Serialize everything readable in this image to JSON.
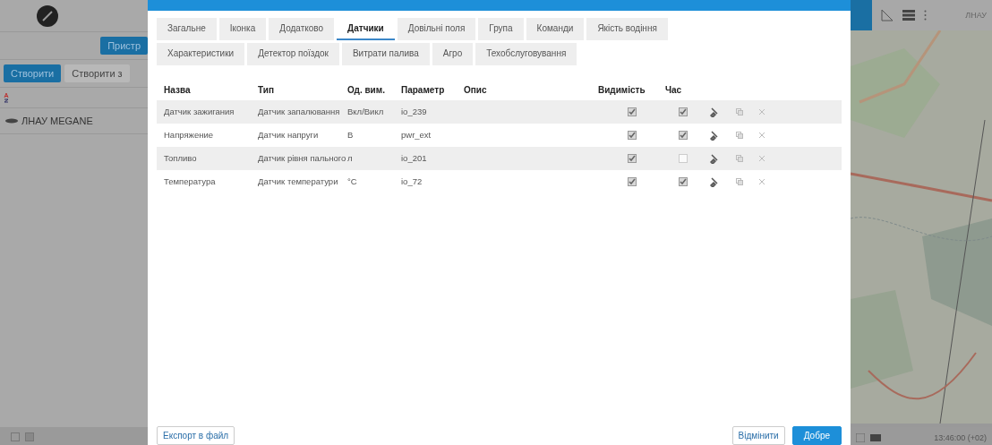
{
  "sidebar": {
    "device_button": "Пристр",
    "create_button": "Створити",
    "create_from_button": "Створити з",
    "units": [
      {
        "name": "ЛНАУ MEGANE",
        "selected": false
      }
    ]
  },
  "dialog": {
    "tab_rows": [
      [
        {
          "label": "Загальне",
          "selected": false
        },
        {
          "label": "Іконка",
          "selected": false
        },
        {
          "label": "Додатково",
          "selected": false
        },
        {
          "label": "Датчики",
          "selected": true
        },
        {
          "label": "Довільні поля",
          "selected": false
        },
        {
          "label": "Група",
          "selected": false
        },
        {
          "label": "Команди",
          "selected": false
        },
        {
          "label": "Якість водіння",
          "selected": false
        }
      ],
      [
        {
          "label": "Характеристики",
          "selected": false
        },
        {
          "label": "Детектор поїздок",
          "selected": false
        },
        {
          "label": "Витрати палива",
          "selected": false
        },
        {
          "label": "Агро",
          "selected": false
        },
        {
          "label": "Техобслуговування",
          "selected": false
        }
      ]
    ],
    "table": {
      "columns": [
        "Назва",
        "Тип",
        "Од. вим.",
        "Параметр",
        "Опис",
        "Видимість",
        "Час"
      ],
      "rows": [
        {
          "name": "Датчик зажигания",
          "type": "Датчик запалювання",
          "unit": "Вкл/Викл",
          "parameter": "io_239",
          "visible": true,
          "time": true
        },
        {
          "name": "Напряжение",
          "type": "Датчик напруги",
          "unit": "В",
          "parameter": "pwr_ext",
          "visible": true,
          "time": true
        },
        {
          "name": "Топливо",
          "type": "Датчик рівня пального",
          "unit": "л",
          "parameter": "io_201",
          "visible": true,
          "time": false
        },
        {
          "name": "Температура",
          "type": "Датчик температури",
          "unit": "°C",
          "parameter": "io_72",
          "visible": true,
          "time": true
        }
      ]
    },
    "export_button": "Експорт в файл",
    "cancel_button": "Відмінити",
    "ok_button": "Добре"
  },
  "map": {
    "user": "ЛНАУ",
    "time": "13:46:00 (+02)"
  }
}
